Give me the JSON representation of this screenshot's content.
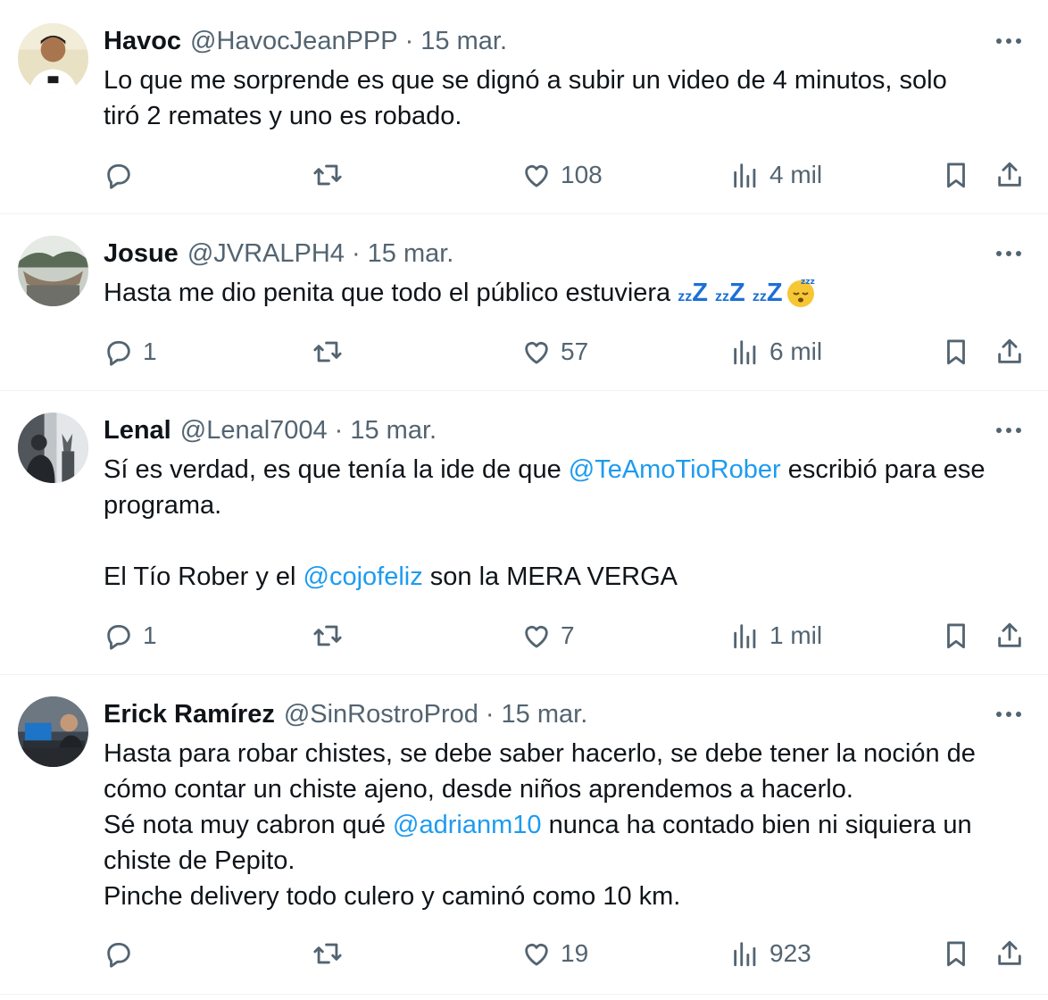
{
  "tweets": [
    {
      "name": "Havoc",
      "handle": "@HavocJeanPPP",
      "date": "15 mar.",
      "lines": [
        "Lo que me sorprende es que se dignó a subir un video de 4 minutos, solo",
        "tiró 2 remates y uno es robado."
      ],
      "replies": "",
      "likes": "108",
      "views": "4 mil"
    },
    {
      "name": "Josue",
      "handle": "@JVRALPH4",
      "date": "15 mar.",
      "text_before_emoji": "Hasta me dio penita que todo el público estuviera ",
      "emoji_label": "sleeping-face",
      "replies": "1",
      "likes": "57",
      "views": "6 mil"
    },
    {
      "name": "Lenal",
      "handle": "@Lenal7004",
      "date": "15 mar.",
      "line1_a": "Sí es verdad, es que tenía la ide de que ",
      "line1_mention": "@TeAmoTioRober",
      "line1_b": " escribió para ese",
      "line2": "programa.",
      "line3_a": "El Tío Rober y el ",
      "line3_mention": "@cojofeliz",
      "line3_b": " son la MERA VERGA",
      "replies": "1",
      "likes": "7",
      "views": "1 mil"
    },
    {
      "name": "Erick Ramírez",
      "handle": "@SinRostroProd",
      "date": "15 mar.",
      "line1": "Hasta para robar chistes, se debe saber hacerlo, se debe tener la noción de",
      "line2": "cómo contar un chiste ajeno, desde niños aprendemos a hacerlo.",
      "line3_a": "Sé nota muy cabron qué ",
      "line3_mention": "@adrianm10",
      "line3_b": " nunca ha contado bien ni siquiera un",
      "line4": "chiste de Pepito.",
      "line5": "Pinche delivery todo culero y caminó como 10 km.",
      "replies": "",
      "likes": "19",
      "views": "923"
    }
  ],
  "separator": "·",
  "icons": [
    "reply-icon",
    "retweet-icon",
    "like-icon",
    "views-icon",
    "bookmark-icon",
    "share-icon",
    "more-icon"
  ],
  "colors": {
    "text": "#0f1419",
    "muted": "#536471",
    "link": "#1d9bf0",
    "border": "#eff3f4"
  }
}
